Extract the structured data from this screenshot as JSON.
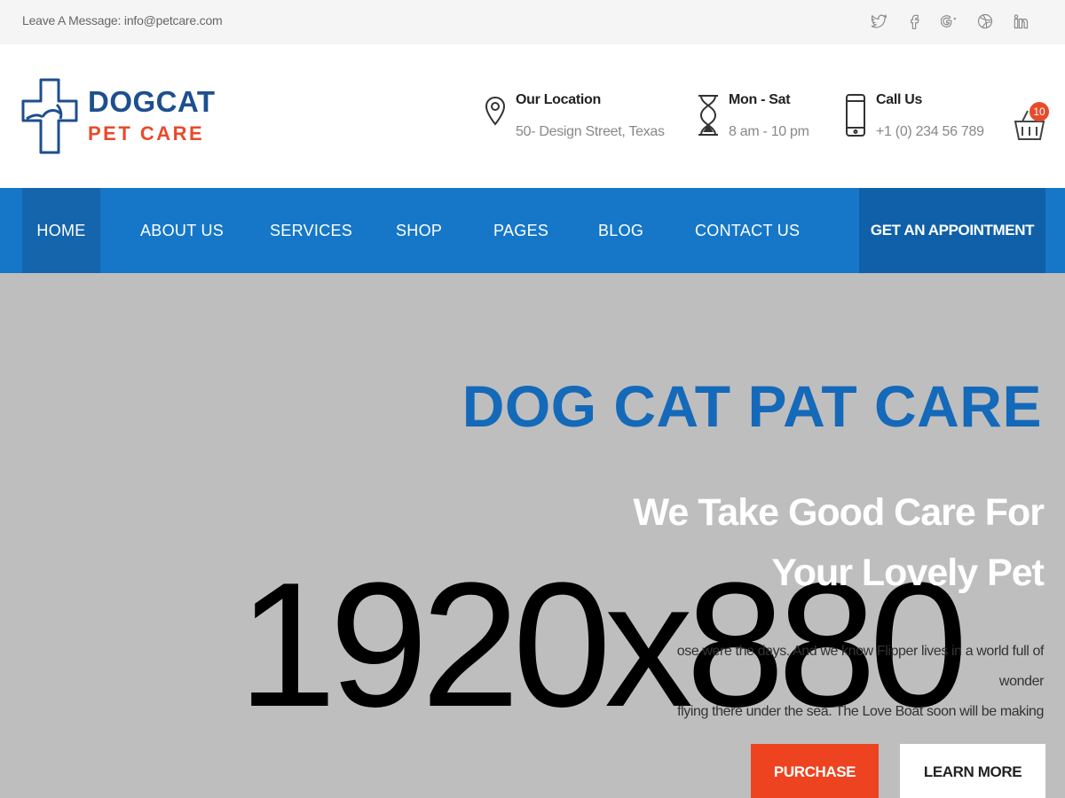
{
  "topbar": {
    "message": "Leave A Message: info@petcare.com",
    "social_icons": [
      "twitter-icon",
      "facebook-icon",
      "google-plus-icon",
      "dribbble-icon",
      "linkedin-icon"
    ]
  },
  "brand": {
    "name_line1": "DOGCAT",
    "name_line2": "PET CARE",
    "primary_color": "#1d4f8f",
    "accent_color": "#e84a2b"
  },
  "header_info": [
    {
      "icon": "location-pin-icon",
      "label": "Our Location",
      "value": "50- Design Street, Texas"
    },
    {
      "icon": "hourglass-icon",
      "label": "Mon - Sat",
      "value": "8 am - 10 pm"
    },
    {
      "icon": "mobile-phone-icon",
      "label": "Call Us",
      "value": "+1 (0) 234 56 789"
    }
  ],
  "cart": {
    "icon": "basket-icon",
    "count": "10"
  },
  "nav": {
    "items": [
      "HOME",
      "ABOUT US",
      "SERVICES",
      "SHOP",
      "PAGES",
      "BLOG",
      "CONTACT US"
    ],
    "active": "HOME",
    "cta": "GET AN APPOINTMENT",
    "color": "#1677c8"
  },
  "hero": {
    "placeholder_text": "1920x880",
    "title": "DOG CAT PAT CARE",
    "subtitle_line1": "We Take Good Care For",
    "subtitle_line2": "Your Lovely Pet",
    "text_line1": "ose were the days. And we know Flipper lives in a world full of wonder",
    "text_line2": "flying there under the sea. The Love Boat soon will be making",
    "btn_purchase": "PURCHASE",
    "btn_learn": "LEARN MORE"
  }
}
